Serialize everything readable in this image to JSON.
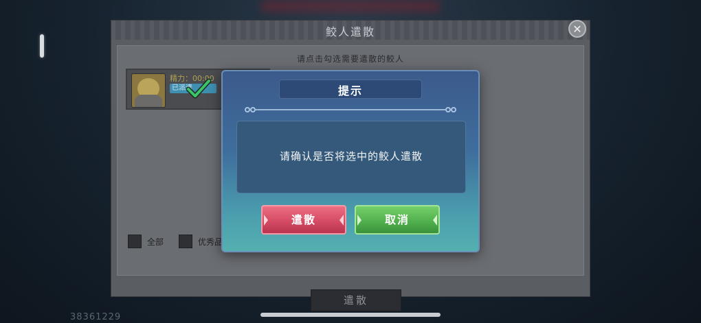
{
  "panel": {
    "title": "鲛人遣散",
    "close_icon": "close-icon",
    "instruction": "请点击勾选需要遣散的鲛人",
    "card": {
      "stat": "精力：00:00",
      "tag": "已派遣",
      "selected": true
    },
    "filters": [
      {
        "label": "全部"
      },
      {
        "label": "优秀品"
      }
    ],
    "dismiss_button": "遣散"
  },
  "dialog": {
    "title": "提示",
    "message": "请确认是否将选中的鲛人遣散",
    "confirm_button": "遣散",
    "cancel_button": "取消"
  },
  "footer": {
    "player_id": "38361229"
  },
  "colors": {
    "confirm": "#d34862",
    "cancel": "#4fae4c",
    "dialog_top": "#3b5a8c",
    "dialog_bottom": "#55b0b0"
  }
}
